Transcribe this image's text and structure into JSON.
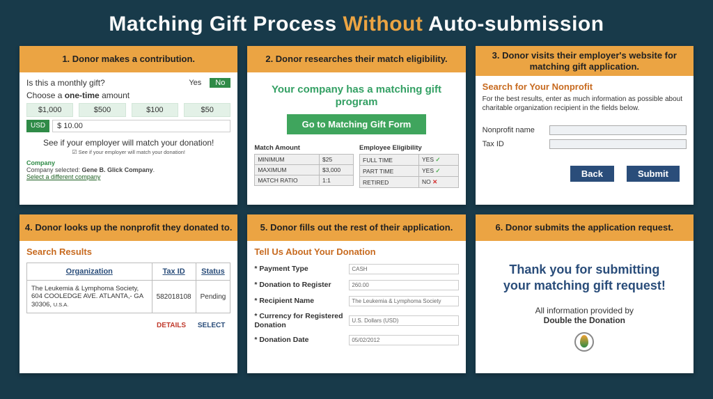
{
  "title_pre": "Matching Gift Process",
  "title_highlight": "Without",
  "title_post": "Auto-submission",
  "cards": {
    "c1": {
      "heading": "1. Donor makes a contribution.",
      "question": "Is this a monthly gift?",
      "yes": "Yes",
      "no": "No",
      "choose_pre": "Choose a",
      "choose_bold": "one-time",
      "choose_post": "amount",
      "amts": [
        "$1,000",
        "$500",
        "$100",
        "$50"
      ],
      "usd": "USD",
      "usd_value": "$ 10.00",
      "match_prompt": "See if your employer will match your donation!",
      "match_sub": "See if your employer will match your donation!",
      "company_lbl": "Company",
      "company_text_pre": "Company selected: ",
      "company_name": "Gene B. Glick Company",
      "diff": "Select a different company"
    },
    "c2": {
      "heading": "2. Donor researches their match eligibility.",
      "msg": "Your company has a matching gift program",
      "button": "Go to Matching Gift Form",
      "col1_h": "Match Amount",
      "col2_h": "Employee Eligibility",
      "rows1": [
        [
          "MINIMUM",
          "$25"
        ],
        [
          "MAXIMUM",
          "$3,000"
        ],
        [
          "MATCH RATIO",
          "1:1"
        ]
      ],
      "rows2": [
        [
          "FULL TIME",
          "YES"
        ],
        [
          "PART TIME",
          "YES"
        ],
        [
          "RETIRED",
          "NO"
        ]
      ]
    },
    "c3": {
      "heading": "3. Donor visits their employer's website for matching gift application.",
      "h": "Search for Your Nonprofit",
      "p": "For the best results, enter as much information as possible about charitable organization recipient in the fields below.",
      "f1": "Nonprofit name",
      "f2": "Tax ID",
      "back": "Back",
      "submit": "Submit"
    },
    "c4": {
      "heading": "4. Donor looks up the nonprofit they donated to.",
      "h": "Search Results",
      "cols": [
        "Organization",
        "Tax ID",
        "Status"
      ],
      "org": "The Leukemia & Lymphoma Society, 604 COOLEDGE AVE. ATLANTA,- GA 30306,",
      "usa": "U.S.A.",
      "taxid": "582018108",
      "status": "Pending",
      "details": "DETAILS",
      "select": "SELECT"
    },
    "c5": {
      "heading": "5. Donor fills out the rest of their application.",
      "h": "Tell Us About Your Donation",
      "fields": [
        {
          "label": "* Payment Type",
          "value": "CASH"
        },
        {
          "label": "* Donation to Register",
          "value": "260.00"
        },
        {
          "label": "* Recipient Name",
          "value": "The Leukemia & Lymphoma Society"
        },
        {
          "label": "* Currency for Registered Donation",
          "value": "U.S. Dollars (USD)"
        },
        {
          "label": "* Donation Date",
          "value": "05/02/2012"
        }
      ]
    },
    "c6": {
      "heading": "6. Donor submits the application request.",
      "msg": "Thank you for submitting your matching gift request!",
      "attr_pre": "All information provided by",
      "attr_bold": "Double the Donation"
    }
  }
}
